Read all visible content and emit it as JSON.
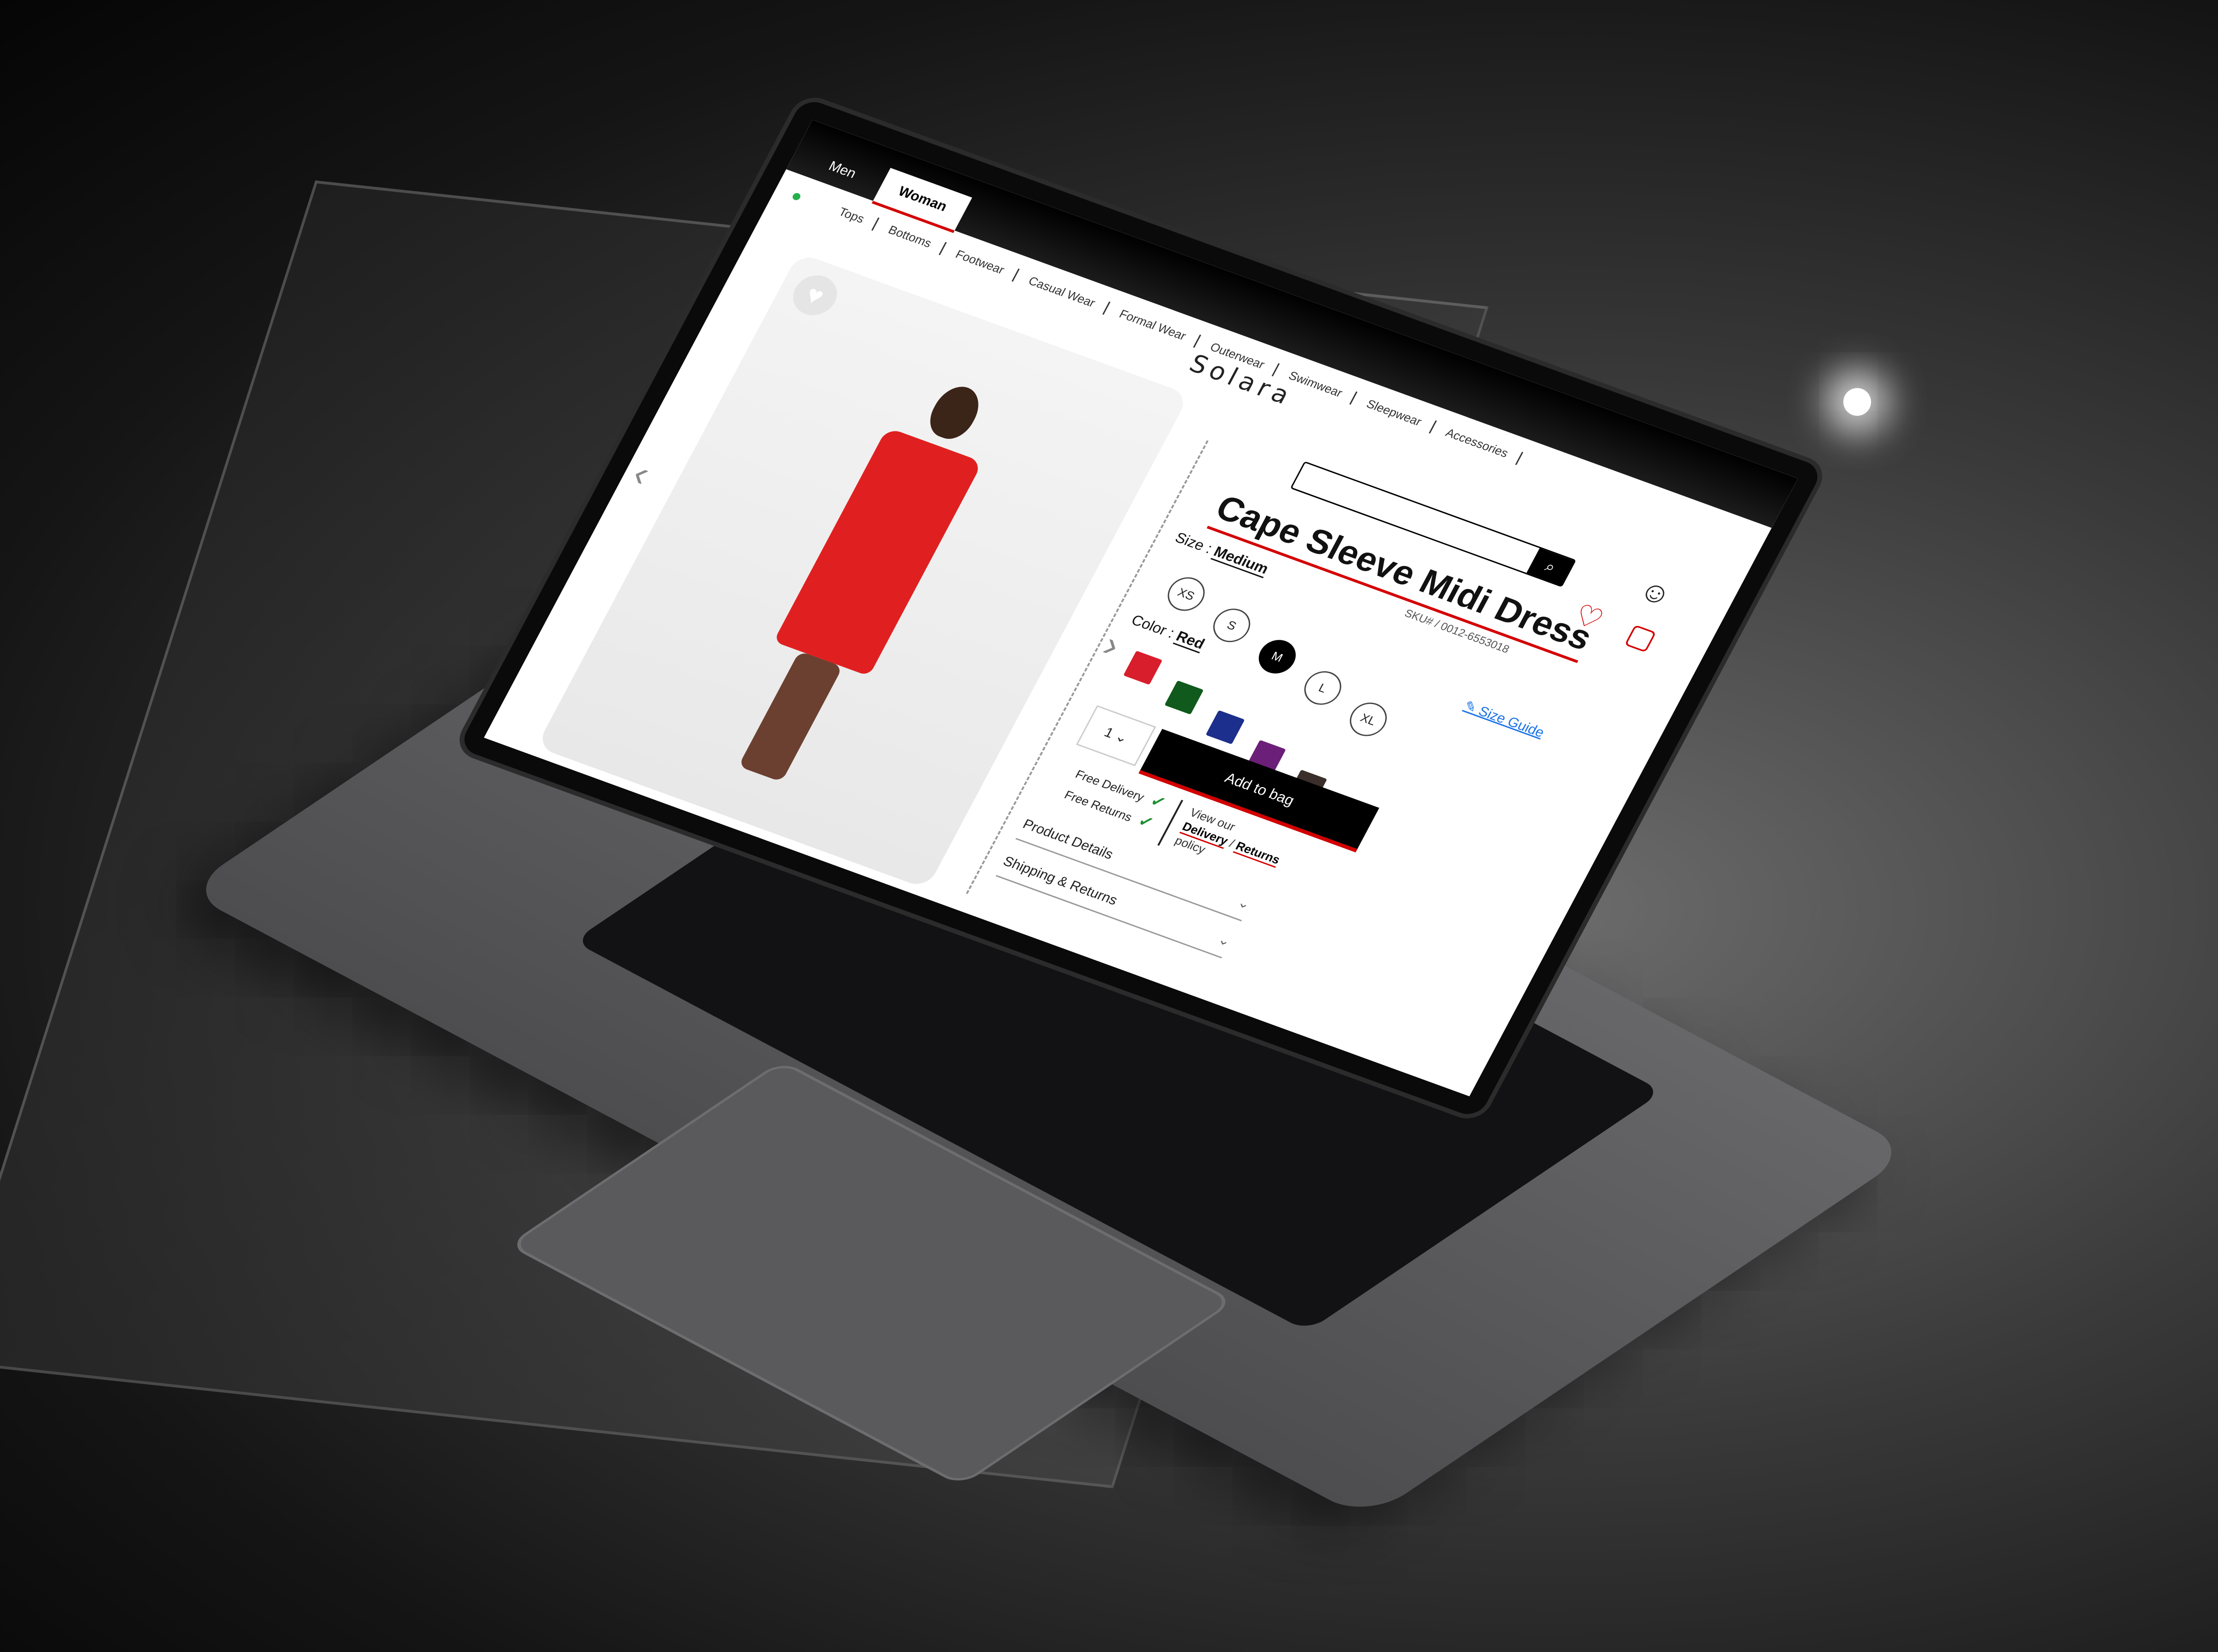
{
  "header": {
    "gender_tabs": [
      "Men",
      "Woman"
    ],
    "brand": "Solara",
    "categories": [
      "Tops",
      "Bottoms",
      "Footwear",
      "Casual Wear",
      "Formal Wear",
      "Outerwear",
      "Swimwear",
      "Sleepwear",
      "Accessories"
    ]
  },
  "product": {
    "title": "Cape Sleeve Midi Dress",
    "sku": "SKU# / 0012-6553018",
    "size_label": "Size :",
    "size_value": "Medium",
    "size_guide": "Size Guide",
    "sizes": [
      "XS",
      "S",
      "M",
      "L",
      "XL"
    ],
    "selected_size": "M",
    "color_label": "Color :",
    "color_value": "Red",
    "colors": [
      "#d81e2c",
      "#0f5a1c",
      "#1c2f8c",
      "#6b1f78",
      "#3a2f2a"
    ],
    "quantity": "1",
    "add_to_bag": "Add to bag",
    "perks": [
      "Free Delivery",
      "Free Returns"
    ],
    "policy": {
      "prefix": "View our",
      "link_delivery": "Delivery",
      "separator": "/",
      "link_returns": "Returns",
      "suffix": "policy"
    },
    "accordions": [
      "Product Details",
      "Shipping & Returns"
    ]
  },
  "icons": {
    "search": "search-icon",
    "user": "user-icon",
    "wishlist": "heart-icon",
    "bag": "shopping-bag-icon"
  },
  "accent_color": "#d40000"
}
